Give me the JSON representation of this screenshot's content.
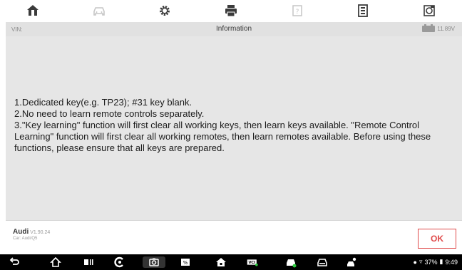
{
  "toolbar": {
    "icons": [
      "home-icon",
      "car-icon",
      "gear-icon",
      "print-icon",
      "help-icon",
      "data-icon",
      "screenshot-icon"
    ]
  },
  "infobar": {
    "vin_label": "VIN:",
    "title": "Information",
    "voltage": "11.89V"
  },
  "message": {
    "lines": [
      "1.Dedicated key(e.g. TP23); #31 key blank.",
      "2.No need to learn remote controls separately.",
      "3.\"Key learning\" function will first clear all working keys, then learn keys available. \"Remote Control Learning\" function will first clear all working remotes, then learn remotes available. Before using these functions, please ensure that all keys are prepared."
    ]
  },
  "footer": {
    "brand": "Audi",
    "version": "V1.90.24",
    "car": "Car: Audi/Q5",
    "ok_label": "OK"
  },
  "navbar": {
    "status_text": "37%",
    "time": "9:49"
  },
  "colors": {
    "accent": "#e04a4a",
    "panel": "#e6e6e6",
    "header": "#e1e1e1"
  }
}
